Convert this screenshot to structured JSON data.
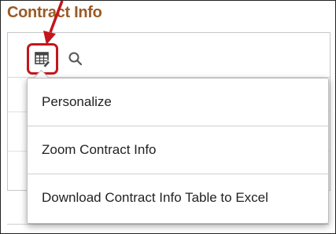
{
  "section": {
    "title": "Contract Info"
  },
  "toolbar": {
    "personalize_icon": "personalize-grid-icon",
    "search_icon": "search-icon",
    "highlight_color": "#c3161c"
  },
  "menu": {
    "items": [
      {
        "label": "Personalize"
      },
      {
        "label": "Zoom Contract Info"
      },
      {
        "label": "Download Contract Info Table to Excel"
      }
    ]
  }
}
